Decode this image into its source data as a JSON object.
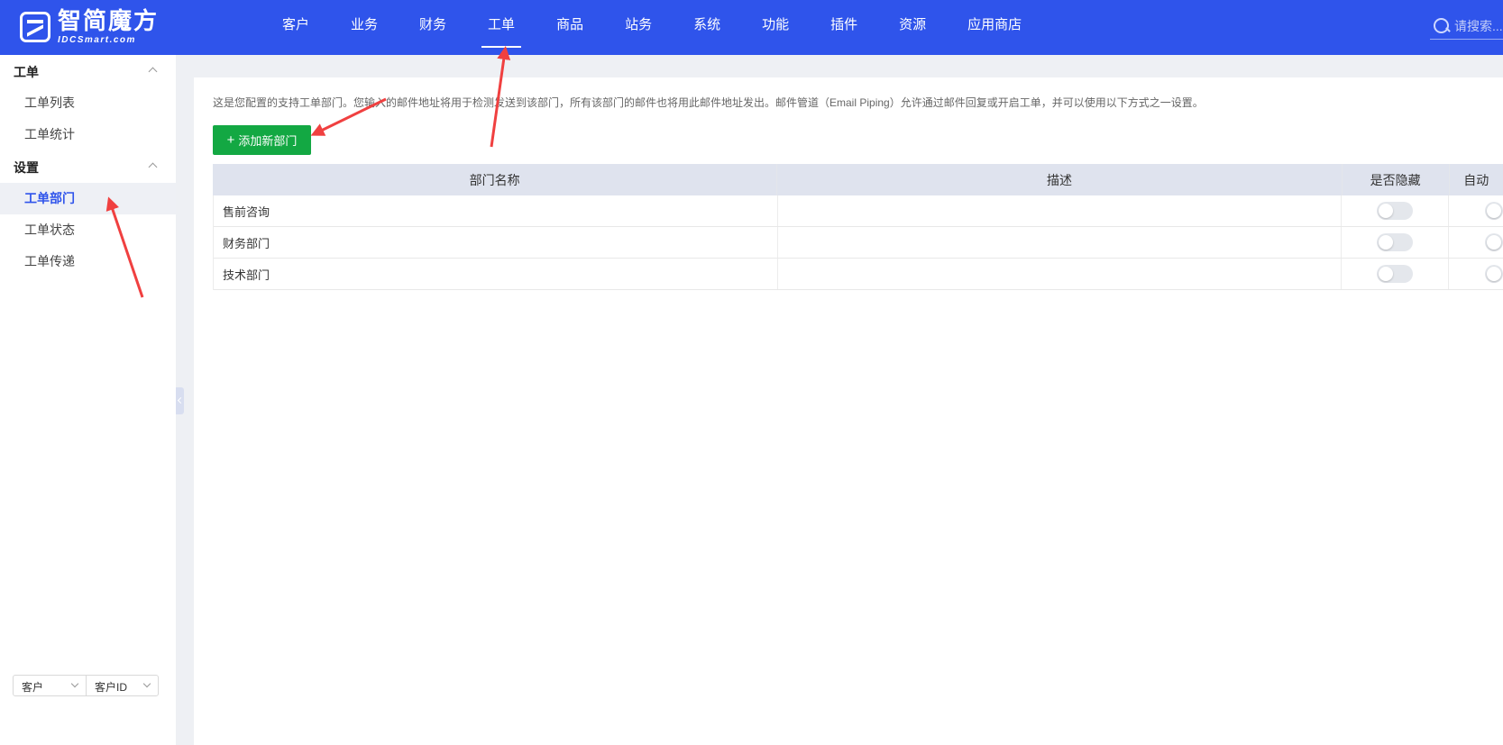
{
  "logo": {
    "cn": "智简魔方",
    "en": "IDCSmart.com"
  },
  "nav": [
    {
      "label": "客户"
    },
    {
      "label": "业务"
    },
    {
      "label": "财务"
    },
    {
      "label": "工单",
      "active": true
    },
    {
      "label": "商品"
    },
    {
      "label": "站务"
    },
    {
      "label": "系统"
    },
    {
      "label": "功能"
    },
    {
      "label": "插件"
    },
    {
      "label": "资源"
    },
    {
      "label": "应用商店"
    }
  ],
  "search": {
    "placeholder": "请搜索..."
  },
  "sidebar": {
    "groups": [
      {
        "title": "工单",
        "items": [
          {
            "label": "工单列表"
          },
          {
            "label": "工单统计"
          }
        ]
      },
      {
        "title": "设置",
        "items": [
          {
            "label": "工单部门",
            "active": true
          },
          {
            "label": "工单状态"
          },
          {
            "label": "工单传递"
          }
        ]
      }
    ],
    "bottom": {
      "select1": "客户",
      "select2": "客户ID"
    }
  },
  "main": {
    "description": "这是您配置的支持工单部门。您输入的邮件地址将用于检测发送到该部门，所有该部门的邮件也将用此邮件地址发出。邮件管道（Email Piping）允许通过邮件回复或开启工单，并可以使用以下方式之一设置。",
    "add_button": "添加新部门",
    "table": {
      "columns": [
        "部门名称",
        "描述",
        "是否隐藏",
        "自动"
      ],
      "rows": [
        {
          "name": "售前咨询",
          "description": "",
          "hidden": false
        },
        {
          "name": "财务部门",
          "description": "",
          "hidden": false
        },
        {
          "name": "技术部门",
          "description": "",
          "hidden": false
        }
      ]
    }
  },
  "colors": {
    "primary": "#2f54eb",
    "success": "#13a843",
    "annotation": "#f04040"
  }
}
